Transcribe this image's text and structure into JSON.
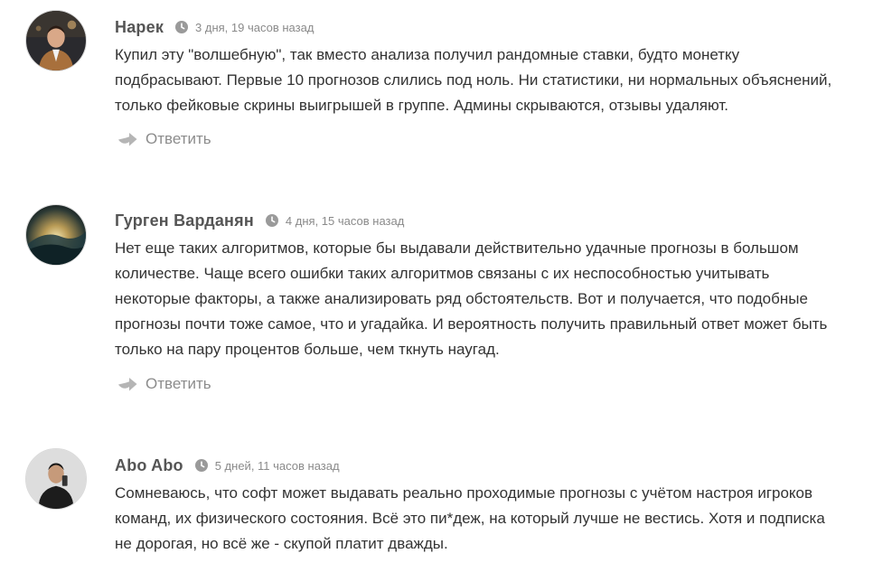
{
  "comments": [
    {
      "author": "Нарек",
      "date": "3 дня, 19 часов назад",
      "lines": [
        "Купил эту \"волшебную\", так вместо анализа получил рандомные ставки, будто монетку",
        "подбрасывают. Первые 10 прогнозов слились под ноль. Ни статистики, ни нормальных объяснений,",
        "только фейковые скрины выигрышей в группе. Админы скрываются, отзывы удаляют."
      ],
      "reply_label": "Ответить"
    },
    {
      "author": "Гурген Варданян",
      "date": "4 дня, 15 часов назад",
      "lines": [
        "Нет еще таких алгоритмов, которые бы выдавали действительно удачные прогнозы в большом",
        "количестве. Чаще всего ошибки таких алгоритмов связаны с их неспособностью учитывать",
        "некоторые факторы, а также анализировать ряд обстоятельств. Вот и получается, что подобные",
        "прогнозы почти тоже самое, что и угадайка. И вероятность получить правильный ответ может быть",
        "только на пару процентов больше, чем ткнуть наугад."
      ],
      "reply_label": "Ответить"
    },
    {
      "author": "Abo Abo",
      "date": "5 дней, 11 часов назад",
      "lines": [
        "Сомневаюсь, что софт может выдавать реально проходимые прогнозы с учётом настроя игроков",
        "команд, их физического состояния. Всё это пи*деж, на который лучше не вестись. Хотя и подписка",
        "не дорогая, но всё же - скупой платит дважды."
      ]
    }
  ],
  "colors": {
    "author": "#555555",
    "date": "#8a8a8a",
    "text": "#333333",
    "reply": "#8c8c8c"
  },
  "icons": {
    "clock": "clock-icon",
    "reply": "reply-arrow-icon"
  }
}
